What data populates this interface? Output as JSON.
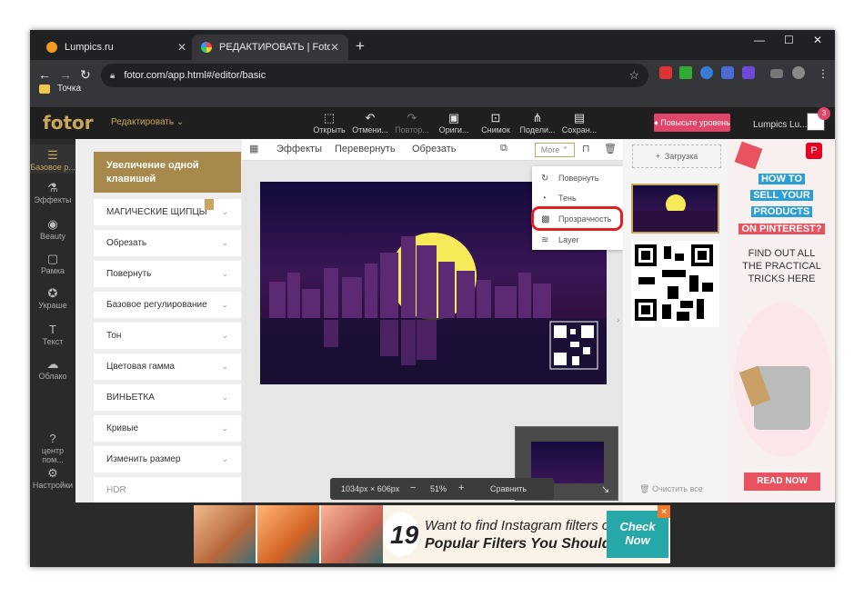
{
  "browser": {
    "tabs": [
      {
        "title": "Lumpics.ru",
        "close": "✕"
      },
      {
        "title": "РЕДАКТИРОВАТЬ | Fotor",
        "close": "✕"
      }
    ],
    "new_tab": "+",
    "address": "fotor.com/app.html#/editor/basic",
    "bookmark": "Точка",
    "ext_badge": "3"
  },
  "fotor": {
    "logo": "fotor",
    "mode": "Редактировать",
    "tools": [
      {
        "label": "Открыть",
        "icon": "open-icon"
      },
      {
        "label": "Отмени...",
        "icon": "undo-icon"
      },
      {
        "label": "Повтор...",
        "icon": "redo-icon"
      },
      {
        "label": "Ориги...",
        "icon": "original-icon"
      },
      {
        "label": "Снимок",
        "icon": "snapshot-icon"
      },
      {
        "label": "Подели...",
        "icon": "share-icon"
      },
      {
        "label": "Сохран...",
        "icon": "save-icon"
      }
    ],
    "upgrade": "Повысьте уровень",
    "user": "Lumpics Lu...",
    "notif_count": "3"
  },
  "rail": [
    {
      "label": "Базовое р...",
      "icon": "sliders-icon"
    },
    {
      "label": "Эффекты",
      "icon": "flask-icon"
    },
    {
      "label": "Beauty",
      "icon": "eye-icon"
    },
    {
      "label": "Рамка",
      "icon": "frame-icon"
    },
    {
      "label": "Украше",
      "icon": "sticker-icon"
    },
    {
      "label": "Текст",
      "icon": "text-icon"
    },
    {
      "label": "Облако",
      "icon": "cloud-icon"
    },
    {
      "label": "центр пом...",
      "icon": "help-icon"
    },
    {
      "label": "Настройки",
      "icon": "gear-icon"
    }
  ],
  "panel": {
    "promo": "Увеличение одной клавишей",
    "items": [
      "МАГИЧЕСКИЕ ЩИПЦЫ",
      "Обрезать",
      "Повернуть",
      "Базовое регулирование",
      "Тон",
      "Цветовая гамма",
      "ВИНЬЕТКА",
      "Кривые",
      "Изменить размер",
      "HDR"
    ]
  },
  "subbar": {
    "items": [
      "Эффекты",
      "Перевернуть",
      "Обрезать"
    ],
    "more": "More"
  },
  "dropdown": [
    {
      "label": "Повернуть",
      "icon": "rotate-icon"
    },
    {
      "label": "Тень",
      "icon": "shadow-icon"
    },
    {
      "label": "Прозрачность",
      "icon": "transparency-icon"
    },
    {
      "label": "Layer",
      "icon": "layers-icon"
    }
  ],
  "zoom": {
    "size": "1034px × 606px",
    "minus": "−",
    "value": "51%",
    "plus": "+",
    "compare": "Сравнить"
  },
  "rpanel": {
    "upload": "Загрузка",
    "clear": "Очистить все"
  },
  "ad_right": {
    "lines": [
      "HOW TO",
      "SELL YOUR",
      "PRODUCTS",
      "ON PINTEREST?",
      "FIND OUT ALL",
      "THE PRACTICAL",
      "TRICKS HERE"
    ],
    "cta": "READ NOW"
  },
  "banner": {
    "number": "19",
    "line1": "Want to find Instagram filters online?",
    "line2": "Popular Filters You Should Try",
    "cta1": "Check",
    "cta2": "Now",
    "close": "✕"
  },
  "colors": {
    "accent": "#c9a65a",
    "upgrade": "#e2456a",
    "highlight": "#e02020"
  }
}
